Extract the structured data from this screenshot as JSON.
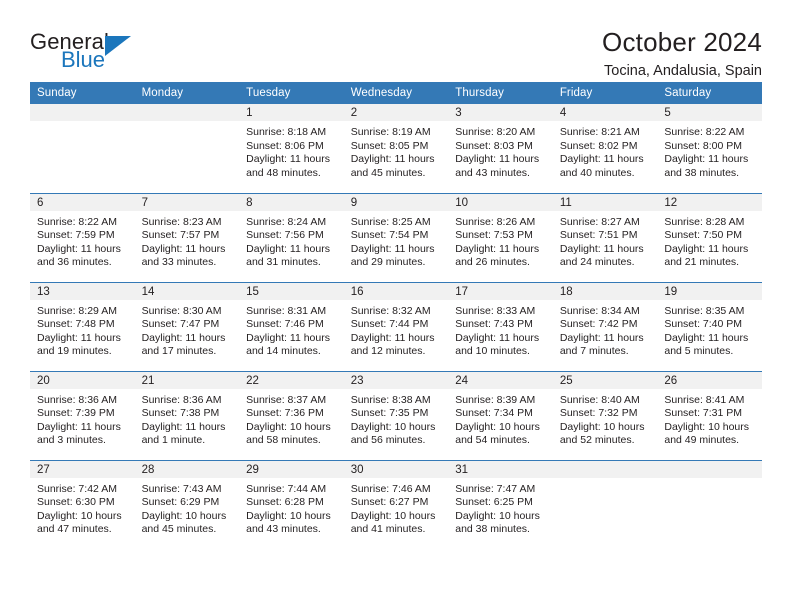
{
  "logo": {
    "word_one": "General",
    "word_two": "Blue",
    "accent_color": "#1b76bc",
    "triangle_icon": "triangle-icon"
  },
  "header": {
    "title": "October 2024",
    "subtitle": "Tocina, Andalusia, Spain"
  },
  "calendar": {
    "header_bg": "#3479b6",
    "daynum_bg": "#f1f1f1",
    "weekdays": [
      "Sunday",
      "Monday",
      "Tuesday",
      "Wednesday",
      "Thursday",
      "Friday",
      "Saturday"
    ],
    "labels": {
      "sunrise": "Sunrise:",
      "sunset": "Sunset:",
      "daylight": "Daylight:"
    },
    "weeks": [
      [
        {
          "day": "",
          "sunrise": "",
          "sunset": "",
          "daylight_line1": "",
          "daylight_line2": ""
        },
        {
          "day": "",
          "sunrise": "",
          "sunset": "",
          "daylight_line1": "",
          "daylight_line2": ""
        },
        {
          "day": "1",
          "sunrise": "Sunrise: 8:18 AM",
          "sunset": "Sunset: 8:06 PM",
          "daylight_line1": "Daylight: 11 hours",
          "daylight_line2": "and 48 minutes."
        },
        {
          "day": "2",
          "sunrise": "Sunrise: 8:19 AM",
          "sunset": "Sunset: 8:05 PM",
          "daylight_line1": "Daylight: 11 hours",
          "daylight_line2": "and 45 minutes."
        },
        {
          "day": "3",
          "sunrise": "Sunrise: 8:20 AM",
          "sunset": "Sunset: 8:03 PM",
          "daylight_line1": "Daylight: 11 hours",
          "daylight_line2": "and 43 minutes."
        },
        {
          "day": "4",
          "sunrise": "Sunrise: 8:21 AM",
          "sunset": "Sunset: 8:02 PM",
          "daylight_line1": "Daylight: 11 hours",
          "daylight_line2": "and 40 minutes."
        },
        {
          "day": "5",
          "sunrise": "Sunrise: 8:22 AM",
          "sunset": "Sunset: 8:00 PM",
          "daylight_line1": "Daylight: 11 hours",
          "daylight_line2": "and 38 minutes."
        }
      ],
      [
        {
          "day": "6",
          "sunrise": "Sunrise: 8:22 AM",
          "sunset": "Sunset: 7:59 PM",
          "daylight_line1": "Daylight: 11 hours",
          "daylight_line2": "and 36 minutes."
        },
        {
          "day": "7",
          "sunrise": "Sunrise: 8:23 AM",
          "sunset": "Sunset: 7:57 PM",
          "daylight_line1": "Daylight: 11 hours",
          "daylight_line2": "and 33 minutes."
        },
        {
          "day": "8",
          "sunrise": "Sunrise: 8:24 AM",
          "sunset": "Sunset: 7:56 PM",
          "daylight_line1": "Daylight: 11 hours",
          "daylight_line2": "and 31 minutes."
        },
        {
          "day": "9",
          "sunrise": "Sunrise: 8:25 AM",
          "sunset": "Sunset: 7:54 PM",
          "daylight_line1": "Daylight: 11 hours",
          "daylight_line2": "and 29 minutes."
        },
        {
          "day": "10",
          "sunrise": "Sunrise: 8:26 AM",
          "sunset": "Sunset: 7:53 PM",
          "daylight_line1": "Daylight: 11 hours",
          "daylight_line2": "and 26 minutes."
        },
        {
          "day": "11",
          "sunrise": "Sunrise: 8:27 AM",
          "sunset": "Sunset: 7:51 PM",
          "daylight_line1": "Daylight: 11 hours",
          "daylight_line2": "and 24 minutes."
        },
        {
          "day": "12",
          "sunrise": "Sunrise: 8:28 AM",
          "sunset": "Sunset: 7:50 PM",
          "daylight_line1": "Daylight: 11 hours",
          "daylight_line2": "and 21 minutes."
        }
      ],
      [
        {
          "day": "13",
          "sunrise": "Sunrise: 8:29 AM",
          "sunset": "Sunset: 7:48 PM",
          "daylight_line1": "Daylight: 11 hours",
          "daylight_line2": "and 19 minutes."
        },
        {
          "day": "14",
          "sunrise": "Sunrise: 8:30 AM",
          "sunset": "Sunset: 7:47 PM",
          "daylight_line1": "Daylight: 11 hours",
          "daylight_line2": "and 17 minutes."
        },
        {
          "day": "15",
          "sunrise": "Sunrise: 8:31 AM",
          "sunset": "Sunset: 7:46 PM",
          "daylight_line1": "Daylight: 11 hours",
          "daylight_line2": "and 14 minutes."
        },
        {
          "day": "16",
          "sunrise": "Sunrise: 8:32 AM",
          "sunset": "Sunset: 7:44 PM",
          "daylight_line1": "Daylight: 11 hours",
          "daylight_line2": "and 12 minutes."
        },
        {
          "day": "17",
          "sunrise": "Sunrise: 8:33 AM",
          "sunset": "Sunset: 7:43 PM",
          "daylight_line1": "Daylight: 11 hours",
          "daylight_line2": "and 10 minutes."
        },
        {
          "day": "18",
          "sunrise": "Sunrise: 8:34 AM",
          "sunset": "Sunset: 7:42 PM",
          "daylight_line1": "Daylight: 11 hours",
          "daylight_line2": "and 7 minutes."
        },
        {
          "day": "19",
          "sunrise": "Sunrise: 8:35 AM",
          "sunset": "Sunset: 7:40 PM",
          "daylight_line1": "Daylight: 11 hours",
          "daylight_line2": "and 5 minutes."
        }
      ],
      [
        {
          "day": "20",
          "sunrise": "Sunrise: 8:36 AM",
          "sunset": "Sunset: 7:39 PM",
          "daylight_line1": "Daylight: 11 hours",
          "daylight_line2": "and 3 minutes."
        },
        {
          "day": "21",
          "sunrise": "Sunrise: 8:36 AM",
          "sunset": "Sunset: 7:38 PM",
          "daylight_line1": "Daylight: 11 hours",
          "daylight_line2": "and 1 minute."
        },
        {
          "day": "22",
          "sunrise": "Sunrise: 8:37 AM",
          "sunset": "Sunset: 7:36 PM",
          "daylight_line1": "Daylight: 10 hours",
          "daylight_line2": "and 58 minutes."
        },
        {
          "day": "23",
          "sunrise": "Sunrise: 8:38 AM",
          "sunset": "Sunset: 7:35 PM",
          "daylight_line1": "Daylight: 10 hours",
          "daylight_line2": "and 56 minutes."
        },
        {
          "day": "24",
          "sunrise": "Sunrise: 8:39 AM",
          "sunset": "Sunset: 7:34 PM",
          "daylight_line1": "Daylight: 10 hours",
          "daylight_line2": "and 54 minutes."
        },
        {
          "day": "25",
          "sunrise": "Sunrise: 8:40 AM",
          "sunset": "Sunset: 7:32 PM",
          "daylight_line1": "Daylight: 10 hours",
          "daylight_line2": "and 52 minutes."
        },
        {
          "day": "26",
          "sunrise": "Sunrise: 8:41 AM",
          "sunset": "Sunset: 7:31 PM",
          "daylight_line1": "Daylight: 10 hours",
          "daylight_line2": "and 49 minutes."
        }
      ],
      [
        {
          "day": "27",
          "sunrise": "Sunrise: 7:42 AM",
          "sunset": "Sunset: 6:30 PM",
          "daylight_line1": "Daylight: 10 hours",
          "daylight_line2": "and 47 minutes."
        },
        {
          "day": "28",
          "sunrise": "Sunrise: 7:43 AM",
          "sunset": "Sunset: 6:29 PM",
          "daylight_line1": "Daylight: 10 hours",
          "daylight_line2": "and 45 minutes."
        },
        {
          "day": "29",
          "sunrise": "Sunrise: 7:44 AM",
          "sunset": "Sunset: 6:28 PM",
          "daylight_line1": "Daylight: 10 hours",
          "daylight_line2": "and 43 minutes."
        },
        {
          "day": "30",
          "sunrise": "Sunrise: 7:46 AM",
          "sunset": "Sunset: 6:27 PM",
          "daylight_line1": "Daylight: 10 hours",
          "daylight_line2": "and 41 minutes."
        },
        {
          "day": "31",
          "sunrise": "Sunrise: 7:47 AM",
          "sunset": "Sunset: 6:25 PM",
          "daylight_line1": "Daylight: 10 hours",
          "daylight_line2": "and 38 minutes."
        },
        {
          "day": "",
          "sunrise": "",
          "sunset": "",
          "daylight_line1": "",
          "daylight_line2": ""
        },
        {
          "day": "",
          "sunrise": "",
          "sunset": "",
          "daylight_line1": "",
          "daylight_line2": ""
        }
      ]
    ]
  }
}
